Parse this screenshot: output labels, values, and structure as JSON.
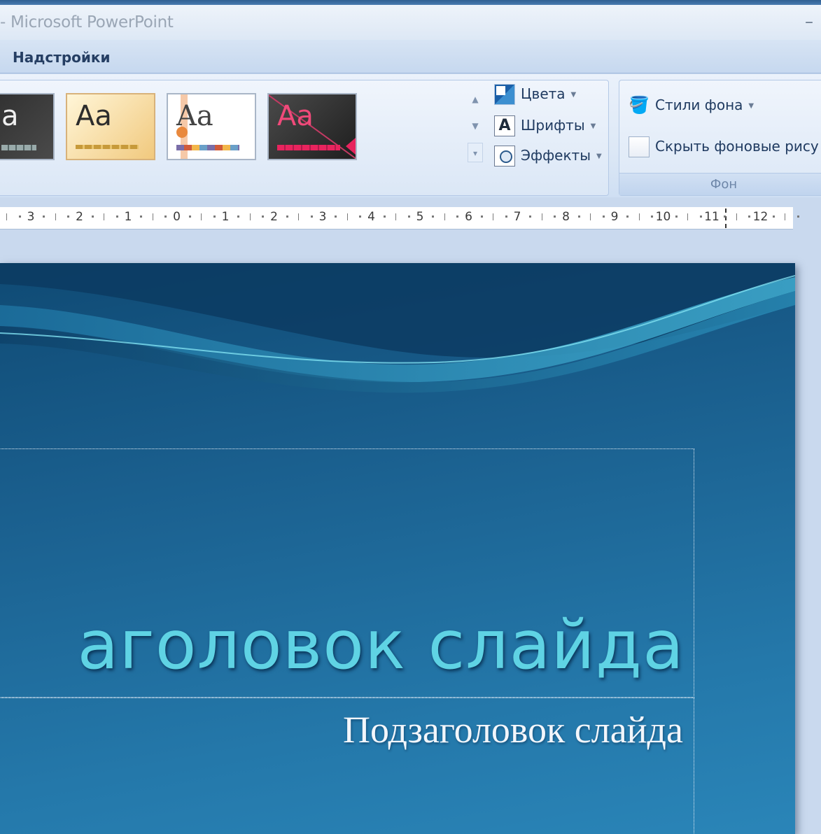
{
  "window": {
    "title": "- Microsoft PowerPoint",
    "minimize_glyph": "–"
  },
  "ribbon_tab": {
    "label": "Надстройки"
  },
  "themes_group": {
    "thumbnails": [
      {
        "sample": "a",
        "style": "dark-gray"
      },
      {
        "sample": "Aa",
        "style": "warm-gold"
      },
      {
        "sample": "Aa",
        "style": "white-orange"
      },
      {
        "sample": "Aa",
        "style": "dark-magenta"
      }
    ],
    "commands": {
      "colors": "Цвета",
      "fonts": "Шрифты",
      "fonts_icon_letter": "A",
      "effects": "Эффекты"
    }
  },
  "background_group": {
    "label": "Фон",
    "styles_button": "Стили фона",
    "hide_checkbox_label": "Скрыть фоновые рису",
    "hide_checked": false
  },
  "ruler": {
    "labels": [
      "3",
      "2",
      "1",
      "0",
      "1",
      "2",
      "3",
      "4",
      "5",
      "6",
      "7",
      "8",
      "9",
      "10",
      "11",
      "12"
    ]
  },
  "slide": {
    "title": "аголовок слайда",
    "subtitle": "Подзаголовок слайда"
  },
  "colors": {
    "slide_top": "#0f4a74",
    "slide_bottom": "#2a85b8",
    "title_text": "#5fd3e4",
    "subtitle_text": "#f2f6fb"
  }
}
